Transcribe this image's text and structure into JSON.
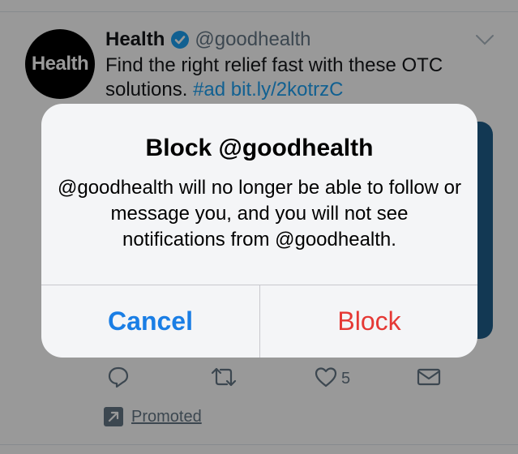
{
  "tweet": {
    "avatar_text": "Health",
    "display_name": "Health",
    "verified_icon": "verified-badge-icon",
    "handle": "@goodhealth",
    "text_plain": "Find the right relief fast with these OTC solutions. ",
    "text_hashtag": "#ad",
    "text_link": "bit.ly/2kotrzC",
    "like_count": "5",
    "promoted_label": "Promoted"
  },
  "actions": {
    "reply_icon": "reply-icon",
    "retweet_icon": "retweet-icon",
    "like_icon": "heart-icon",
    "dm_icon": "envelope-icon"
  },
  "alert": {
    "title": "Block @goodhealth",
    "message": "@goodhealth will no longer be able to follow or message you, and you will not see notifications from @goodhealth.",
    "cancel_label": "Cancel",
    "block_label": "Block"
  },
  "colors": {
    "link": "#1da1f2",
    "secondary_text": "#657786",
    "cancel": "#1a7ee5",
    "destructive": "#e53935"
  }
}
